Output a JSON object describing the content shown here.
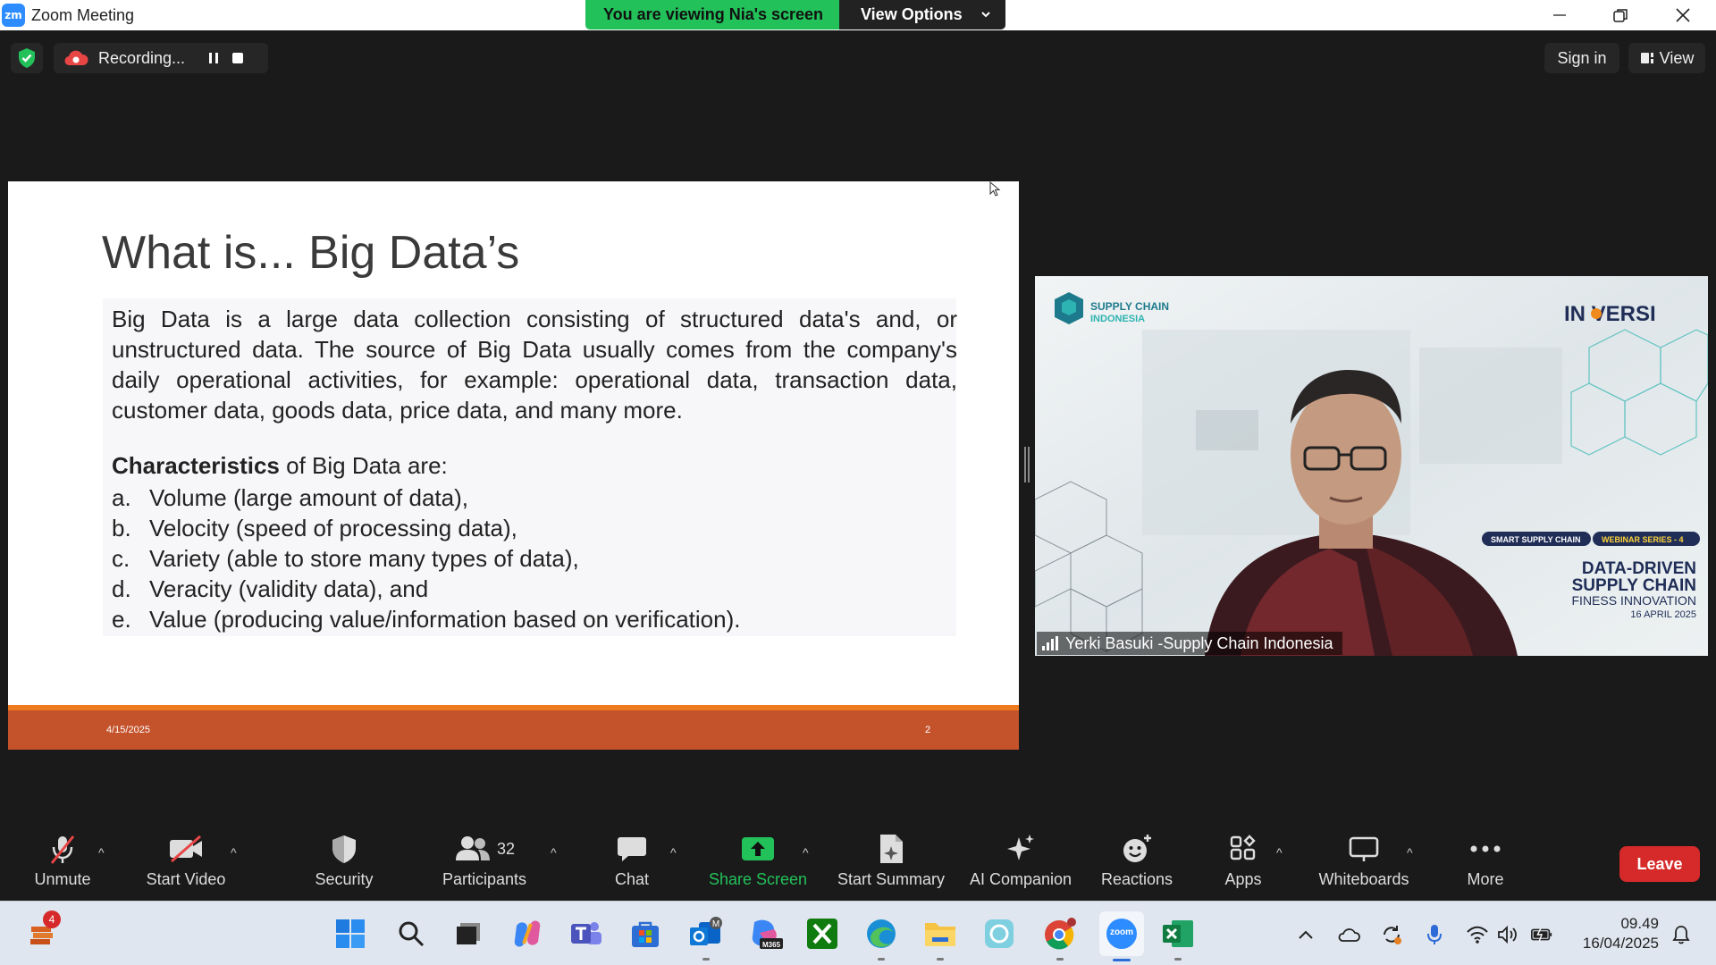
{
  "window": {
    "title": "Zoom Meeting",
    "logo_text": "zm",
    "viewing_banner": "You are viewing Nia's screen",
    "view_options": "View Options"
  },
  "topbar": {
    "recording_label": "Recording...",
    "sign_in": "Sign in",
    "view": "View"
  },
  "slide": {
    "title": "What is... Big Data’s",
    "paragraph": "Big Data is a large data collection consisting of structured data's and, or unstructured data. The source of Big Data usually comes from the company's daily operational activities, for example: operational data, transaction data, customer data, goods data, price data, and many more.",
    "char_bold": "Characteristics",
    "char_rest": " of Big Data are:",
    "items": [
      {
        "letter": "a.",
        "text": "Volume (large amount of data),"
      },
      {
        "letter": "b.",
        "text": "Velocity (speed of processing data),"
      },
      {
        "letter": "c.",
        "text": "Variety (able to store many types of data),"
      },
      {
        "letter": "d.",
        "text": "Veracity (validity data), and"
      },
      {
        "letter": "e.",
        "text": "Value (producing value/information based on verification)."
      }
    ],
    "footer_date": "4/15/2025",
    "page_number": "2"
  },
  "video": {
    "participant_name": "Yerki Basuki -Supply Chain Indonesia",
    "bg_logo_line1": "SUPPLY CHAIN",
    "bg_logo_line2": "INDONESIA",
    "bg_brand": "IN VERSI",
    "bg_tag1": "SMART SUPPLY CHAIN",
    "bg_tag2": "WEBINAR SERIES - 4",
    "bg_head1": "DATA-DRIVEN",
    "bg_head2": "SUPPLY CHAIN",
    "bg_head3": "FINESS INNOVATION",
    "bg_date": "16 APRIL 2025"
  },
  "toolbar": {
    "unmute": "Unmute",
    "start_video": "Start Video",
    "security": "Security",
    "participants": "Participants",
    "participants_count": "32",
    "chat": "Chat",
    "share_screen": "Share Screen",
    "start_summary": "Start Summary",
    "ai_companion": "AI Companion",
    "reactions": "Reactions",
    "apps": "Apps",
    "whiteboards": "Whiteboards",
    "more": "More",
    "leave": "Leave"
  },
  "taskbar": {
    "badge_count": "4",
    "m365_label": "M365",
    "zoom_label": "zoom",
    "time": "09.49",
    "date": "16/04/2025"
  },
  "colors": {
    "zoom_blue": "#2d8cff",
    "green": "#23c15a",
    "leave_red": "#d62a2a",
    "slide_footer": "#c4532c",
    "slide_footer_line": "#ee7a20"
  }
}
